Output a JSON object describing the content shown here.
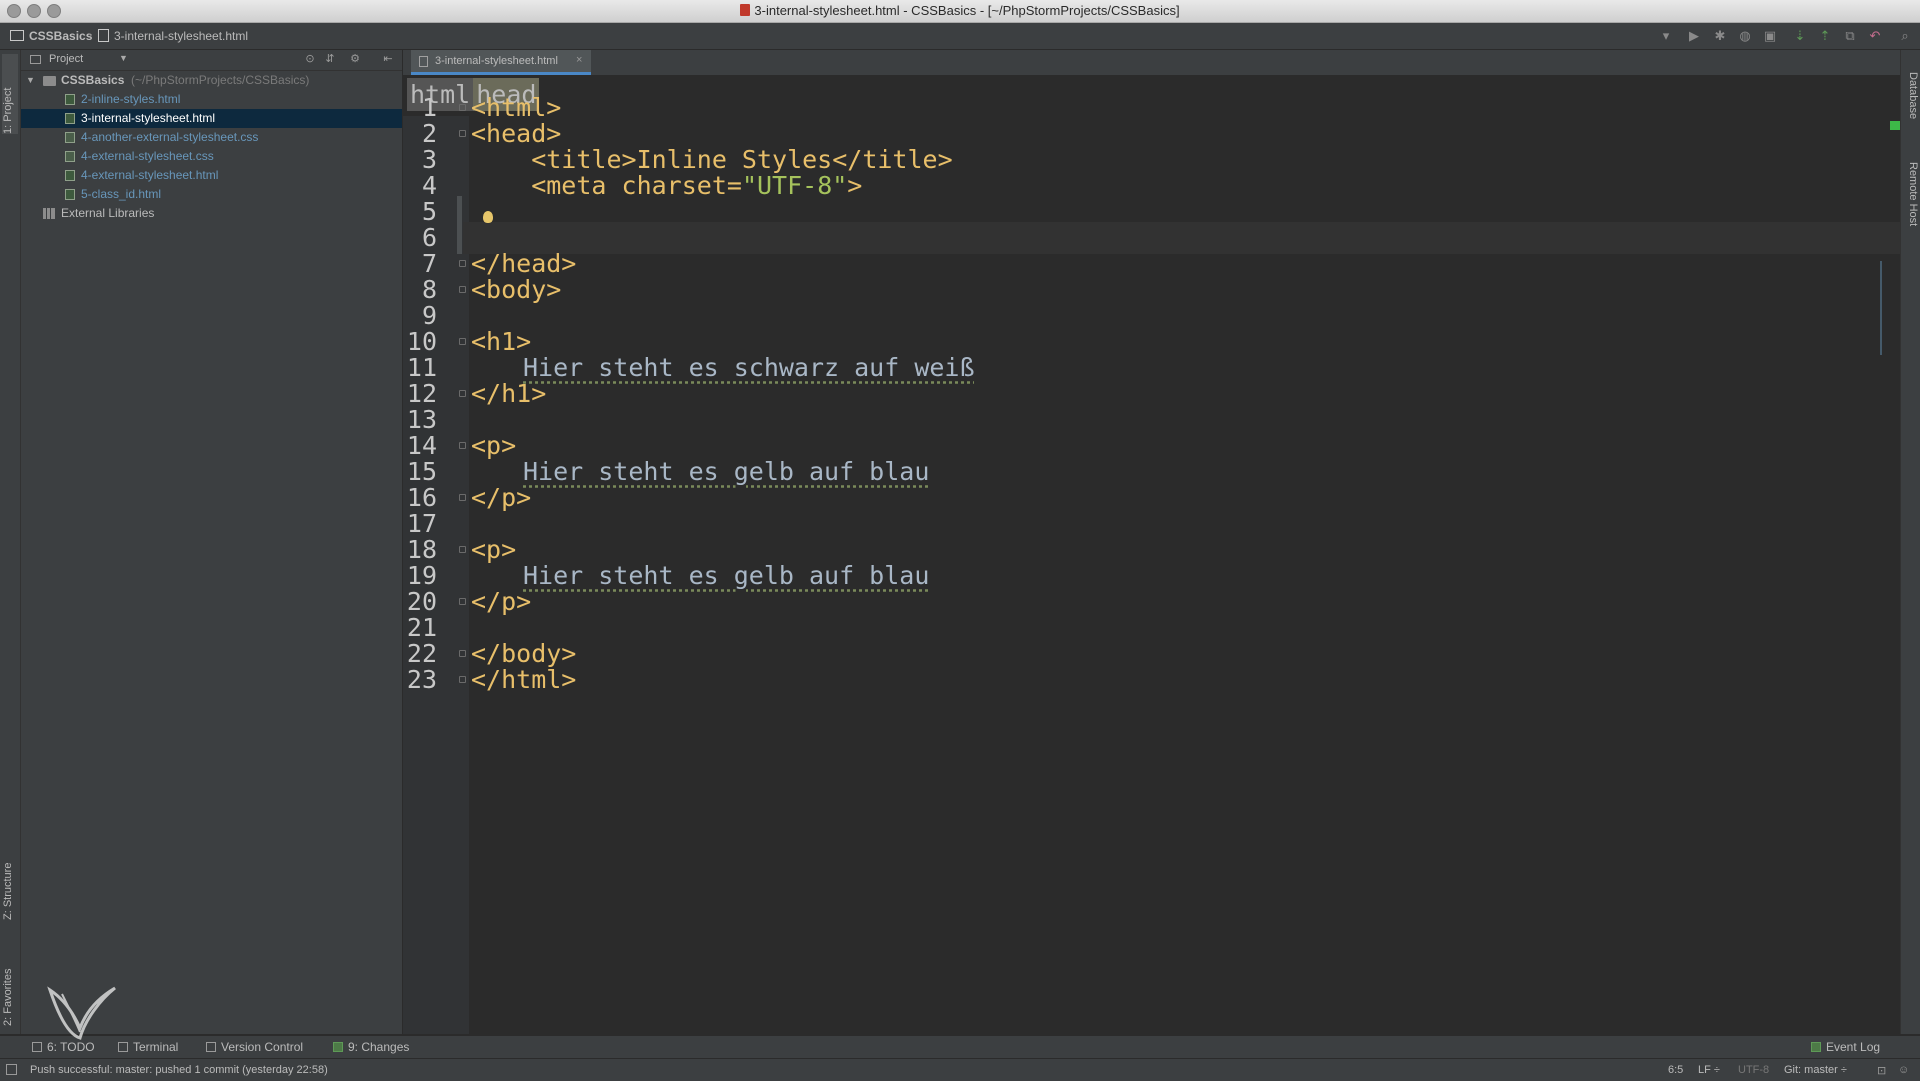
{
  "window": {
    "title": "3-internal-stylesheet.html - CSSBasics - [~/PhpStormProjects/CSSBasics]"
  },
  "navbar": {
    "crumbs": [
      "CSSBasics",
      "3-internal-stylesheet.html"
    ]
  },
  "left_stripe": {
    "project_tab": "1: Project",
    "structure_tab": "Z: Structure",
    "favorites_tab": "2: Favorites"
  },
  "right_stripe": {
    "database_tab": "Database",
    "remote_host_tab": "Remote Host"
  },
  "project_panel": {
    "header": "Project",
    "root": {
      "name": "CSSBasics",
      "path": "(~/PhpStormProjects/CSSBasics)"
    },
    "files": [
      {
        "name": "2-inline-styles.html",
        "type": "html"
      },
      {
        "name": "3-internal-stylesheet.html",
        "type": "html",
        "selected": true
      },
      {
        "name": "4-another-external-stylesheet.css",
        "type": "css"
      },
      {
        "name": "4-external-stylesheet.css",
        "type": "css"
      },
      {
        "name": "4-external-stylesheet.html",
        "type": "html"
      },
      {
        "name": "5-class_id.html",
        "type": "html"
      }
    ],
    "external_libraries": "External Libraries"
  },
  "editor": {
    "tab_label": "3-internal-stylesheet.html",
    "breadcrumbs": [
      "html",
      "head"
    ],
    "line_numbers": [
      "1",
      "2",
      "3",
      "4",
      "5",
      "6",
      "7",
      "8",
      "9",
      "10",
      "11",
      "12",
      "13",
      "14",
      "15",
      "16",
      "17",
      "18",
      "19",
      "20",
      "21",
      "22",
      "23"
    ],
    "lines": {
      "l1": "<html>",
      "l2": "<head>",
      "l3": "    <title>Inline Styles</title>",
      "l4a": "    <meta charset=",
      "l4b": "\"UTF-8\"",
      "l4c": ">",
      "l7": "</head>",
      "l8": "<body>",
      "l10": "<h1>",
      "l11": "Hier steht es schwarz auf weiß",
      "l12": "</h1>",
      "l14": "<p>",
      "l15": "Hier steht es gelb auf blau",
      "l16": "</p>",
      "l18": "<p>",
      "l19": "Hier steht es gelb auf blau",
      "l20": "</p>",
      "l22": "</body>",
      "l23": "</html>"
    }
  },
  "tool_buttons": {
    "todo": "6: TODO",
    "terminal": "Terminal",
    "version_control": "Version Control",
    "changes": "9: Changes",
    "event_log": "Event Log"
  },
  "status": {
    "message": "Push successful: master: pushed 1 commit (yesterday 22:58)",
    "position": "6:5",
    "line_sep": "LF ÷",
    "encoding": "UTF-8",
    "git": "Git: master ÷"
  },
  "colors": {
    "tag": "#e8bf6a",
    "text": "#a9b7c6",
    "string": "#a5c25c",
    "selection": "#0d293e",
    "editor_bg": "#2b2b2b",
    "panel_bg": "#3c3f41"
  }
}
